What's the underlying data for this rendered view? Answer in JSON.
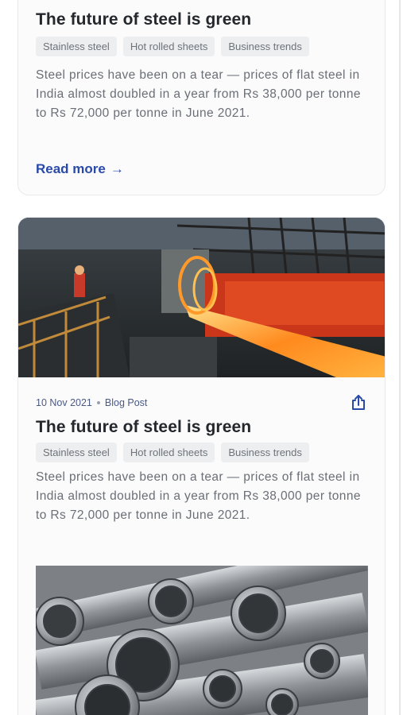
{
  "card1": {
    "title": "The future of steel is green",
    "tags": [
      "Stainless steel",
      "Hot rolled sheets",
      "Business trends"
    ],
    "excerpt": "Steel prices have been on a tear — prices of flat steel in India almost doubled in a year from Rs 38,000 per tonne to Rs 72,000 per tonne in June 2021.",
    "read_more": "Read more",
    "arrow": "→"
  },
  "card2": {
    "date": "10 Nov 2021",
    "type": "Blog Post",
    "title": "The future of steel is green",
    "tags": [
      "Stainless steel",
      "Hot rolled sheets",
      "Business trends"
    ],
    "excerpt": "Steel prices have been on a tear — prices of flat steel in India almost doubled in a year from Rs 38,000 per tonne to Rs 72,000 per tonne in June 2021."
  },
  "icons": {
    "share": "share-icon",
    "arrow": "arrow-right-icon"
  },
  "colors": {
    "accent": "#2a4aa8",
    "tag_bg": "#eceef0",
    "text": "#24272c",
    "muted": "#6a6f76"
  }
}
